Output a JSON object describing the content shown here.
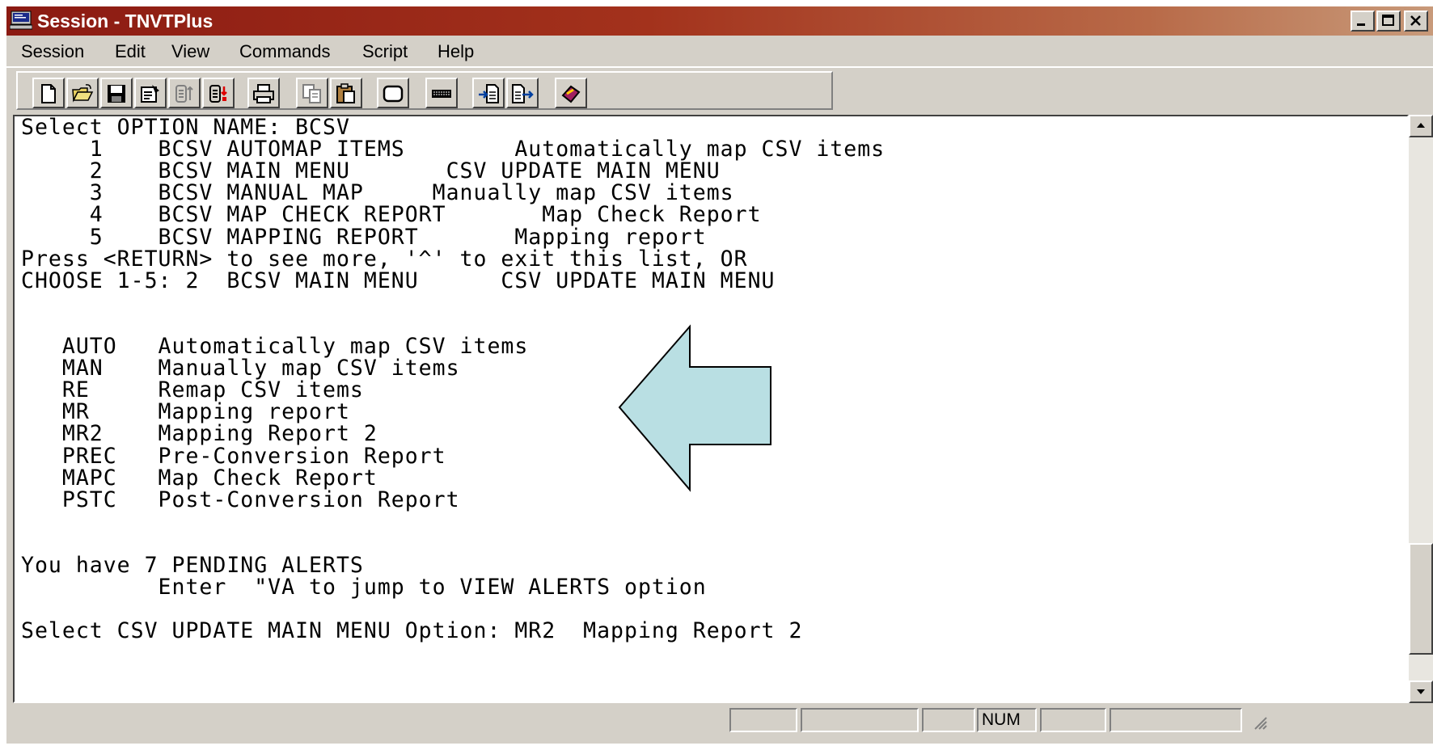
{
  "window": {
    "title": "Session - TNVTPlus",
    "buttons": [
      "minimize-button",
      "maximize-button",
      "close-button"
    ]
  },
  "menu": {
    "items": [
      "Session",
      "Edit",
      "View",
      "Commands",
      "Script",
      "Help"
    ]
  },
  "toolbar": {
    "icons": [
      "new-file-icon",
      "open-folder-icon",
      "save-icon",
      "properties-icon",
      "disconnect-icon",
      "connect-icon",
      "print-icon",
      "copy-icon",
      "paste-icon",
      "rectangle-icon",
      "keyboard-icon",
      "receive-file-icon",
      "send-file-icon",
      "eraser-icon"
    ]
  },
  "terminal": {
    "lines": [
      "Select OPTION NAME: BCSV",
      "     1    BCSV AUTOMAP ITEMS        Automatically map CSV items",
      "     2    BCSV MAIN MENU       CSV UPDATE MAIN MENU",
      "     3    BCSV MANUAL MAP     Manually map CSV items",
      "     4    BCSV MAP CHECK REPORT       Map Check Report",
      "     5    BCSV MAPPING REPORT       Mapping report",
      "Press <RETURN> to see more, '^' to exit this list, OR",
      "CHOOSE 1-5: 2  BCSV MAIN MENU      CSV UPDATE MAIN MENU",
      "",
      "",
      "   AUTO   Automatically map CSV items",
      "   MAN    Manually map CSV items",
      "   RE     Remap CSV items",
      "   MR     Mapping report",
      "   MR2    Mapping Report 2",
      "   PREC   Pre-Conversion Report",
      "   MAPC   Map Check Report",
      "   PSTC   Post-Conversion Report",
      "",
      "",
      "You have 7 PENDING ALERTS",
      "          Enter  \"VA to jump to VIEW ALERTS option",
      "",
      "Select CSV UPDATE MAIN MENU Option: MR2  Mapping Report 2"
    ]
  },
  "annotation": {
    "arrow_color": "#b9dfe3",
    "arrow_direction": "left"
  },
  "statusbar": {
    "indicator": "NUM"
  },
  "colors": {
    "title_start": "#8b1a12",
    "title_end": "#c89a7a",
    "chrome": "#d4d0c8",
    "terminal_bg": "#ffffff"
  }
}
